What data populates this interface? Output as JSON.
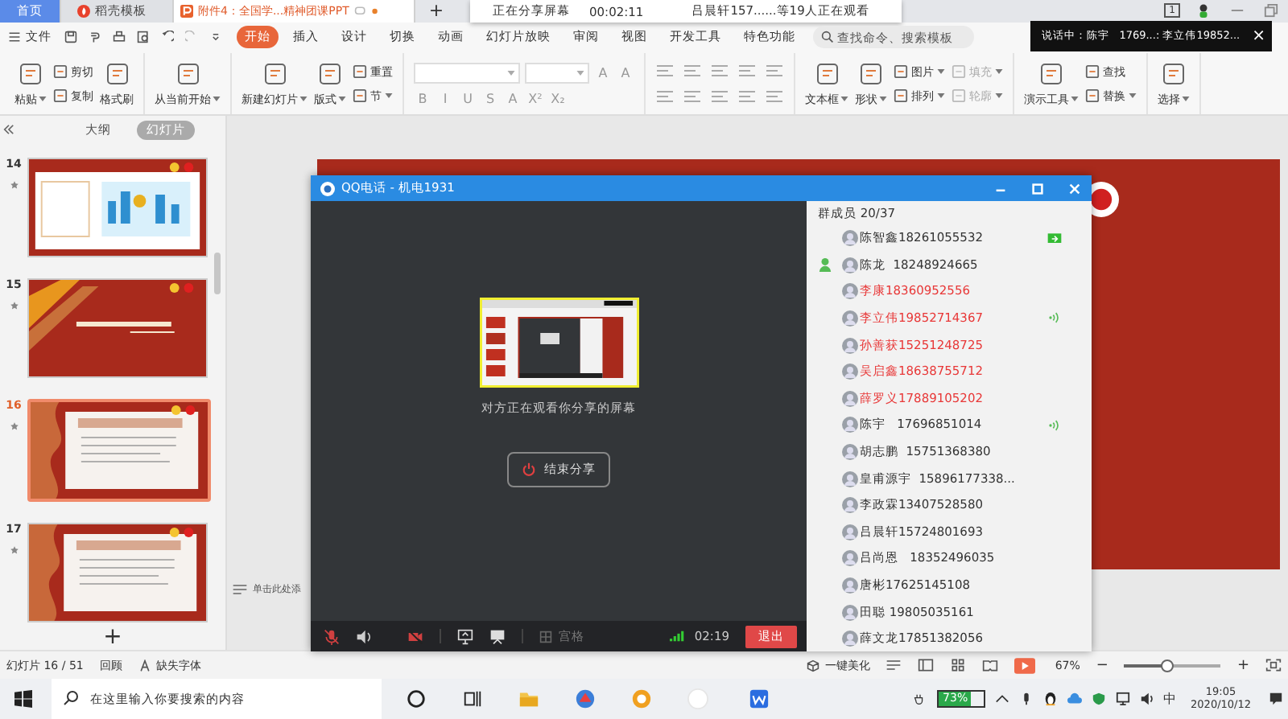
{
  "tabs": [
    {
      "label": "首页",
      "kind": "home",
      "selected": false
    },
    {
      "label": "稻壳模板",
      "kind": "docer",
      "selected": false
    },
    {
      "label": "附件4：全国学...精神团课PPT",
      "kind": "doc",
      "selected": true
    }
  ],
  "new_tab": "+",
  "share_banner": {
    "status": "正在分享屏幕",
    "elapsed": "00:02:11",
    "viewers": "吕晨轩157......等19人正在观看"
  },
  "window_count": "1",
  "menu": {
    "file": "文件",
    "tabs": [
      {
        "label": "开始",
        "selected": true
      },
      {
        "label": "插入",
        "selected": false
      },
      {
        "label": "设计",
        "selected": false
      },
      {
        "label": "切换",
        "selected": false
      },
      {
        "label": "动画",
        "selected": false
      },
      {
        "label": "幻灯片放映",
        "selected": false
      },
      {
        "label": "审阅",
        "selected": false
      },
      {
        "label": "视图",
        "selected": false
      },
      {
        "label": "开发工具",
        "selected": false
      },
      {
        "label": "特色功能",
        "selected": false
      }
    ],
    "search": {
      "placeholder": "查找命令、搜索模板"
    }
  },
  "speaking_toast": {
    "text": "说话中：陈宇   1769...: 李立伟19852...",
    "close": "×"
  },
  "ribbon": {
    "groups": [
      {
        "tools": [
          {
            "kind": "large",
            "label": "粘贴",
            "caret": true
          },
          {
            "kind": "pair",
            "items": [
              {
                "label": "剪切",
                "caret": false,
                "disabled": false
              },
              {
                "label": "复制",
                "caret": false,
                "disabled": false
              }
            ]
          },
          {
            "kind": "large",
            "label": "格式刷",
            "caret": false
          }
        ]
      },
      {
        "tools": [
          {
            "kind": "large",
            "label": "从当前开始",
            "caret": true
          }
        ]
      },
      {
        "tools": [
          {
            "kind": "large",
            "label": "新建幻灯片",
            "caret": true
          },
          {
            "kind": "large",
            "label": "版式",
            "caret": true
          },
          {
            "kind": "pair",
            "items": [
              {
                "label": "重置",
                "caret": false,
                "disabled": false
              },
              {
                "label": "节",
                "caret": true,
                "disabled": false
              }
            ]
          }
        ]
      },
      {
        "tools": [
          {
            "kind": "font",
            "size_buttons": [
              "A",
              "A"
            ],
            "format_buttons": [
              "B",
              "I",
              "U",
              "S",
              "A",
              "X²",
              "X₂"
            ]
          }
        ]
      },
      {
        "tools": [
          {
            "kind": "paragraph"
          }
        ]
      },
      {
        "tools": [
          {
            "kind": "large",
            "label": "文本框",
            "caret": true
          },
          {
            "kind": "large",
            "label": "形状",
            "caret": true
          },
          {
            "kind": "pair",
            "items": [
              {
                "label": "图片",
                "caret": true,
                "disabled": false
              },
              {
                "label": "排列",
                "caret": true,
                "disabled": false
              }
            ]
          },
          {
            "kind": "pair",
            "items": [
              {
                "label": "填充",
                "caret": true,
                "disabled": true
              },
              {
                "label": "轮廓",
                "caret": true,
                "disabled": true
              }
            ]
          }
        ]
      },
      {
        "tools": [
          {
            "kind": "large",
            "label": "演示工具",
            "caret": true
          },
          {
            "kind": "pair",
            "items": [
              {
                "label": "查找",
                "caret": false,
                "disabled": false
              },
              {
                "label": "替换",
                "caret": true,
                "disabled": false
              }
            ]
          }
        ]
      },
      {
        "tools": [
          {
            "kind": "large",
            "label": "选择",
            "caret": true
          }
        ]
      }
    ]
  },
  "slide_panel": {
    "tabs": [
      {
        "label": "大纲",
        "selected": false
      },
      {
        "label": "幻灯片",
        "selected": true
      }
    ],
    "slides": [
      {
        "number": "14",
        "kind": "city",
        "selected": false
      },
      {
        "number": "15",
        "kind": "section",
        "selected": false
      },
      {
        "number": "16",
        "kind": "text",
        "selected": true
      },
      {
        "number": "17",
        "kind": "text",
        "selected": false
      }
    ],
    "add": "+"
  },
  "notes": {
    "placeholder": "单击此处添"
  },
  "call_window": {
    "title": "QQ电话 - 机电1931",
    "message": "对方正在观看你分享的屏幕",
    "stop_button": "结束分享",
    "layout_button": "宫格",
    "duration": "02:19",
    "exit_button": "退出",
    "mic_muted": true,
    "camera_off": true,
    "members_header": "群成员 20/37",
    "members": [
      {
        "label": "陈智鑫18261055532",
        "highlighted": false,
        "admin": false,
        "sharing": true,
        "speaking": false
      },
      {
        "label": "陈龙  18248924665",
        "highlighted": false,
        "admin": true,
        "sharing": false,
        "speaking": false
      },
      {
        "label": "李康18360952556",
        "highlighted": true,
        "admin": false,
        "sharing": false,
        "speaking": false
      },
      {
        "label": "李立伟19852714367",
        "highlighted": true,
        "admin": false,
        "sharing": false,
        "speaking": true
      },
      {
        "label": "孙善获15251248725",
        "highlighted": true,
        "admin": false,
        "sharing": false,
        "speaking": false
      },
      {
        "label": "吴启鑫18638755712",
        "highlighted": true,
        "admin": false,
        "sharing": false,
        "speaking": false
      },
      {
        "label": "薛罗义17889105202",
        "highlighted": true,
        "admin": false,
        "sharing": false,
        "speaking": false
      },
      {
        "label": "陈宇   17696851014",
        "highlighted": false,
        "admin": false,
        "sharing": false,
        "speaking": true
      },
      {
        "label": "胡志鹏  15751368380",
        "highlighted": false,
        "admin": false,
        "sharing": false,
        "speaking": false
      },
      {
        "label": "皇甫源宇  15896177338...",
        "highlighted": false,
        "admin": false,
        "sharing": false,
        "speaking": false
      },
      {
        "label": "李政霖13407528580",
        "highlighted": false,
        "admin": false,
        "sharing": false,
        "speaking": false
      },
      {
        "label": "吕晨轩15724801693",
        "highlighted": false,
        "admin": false,
        "sharing": false,
        "speaking": false
      },
      {
        "label": "吕尚恩   18352496035",
        "highlighted": false,
        "admin": false,
        "sharing": false,
        "speaking": false
      },
      {
        "label": "唐彬17625145108",
        "highlighted": false,
        "admin": false,
        "sharing": false,
        "speaking": false
      },
      {
        "label": "田聪 19805035161",
        "highlighted": false,
        "admin": false,
        "sharing": false,
        "speaking": false
      },
      {
        "label": "薛文龙17851382056",
        "highlighted": false,
        "admin": false,
        "sharing": false,
        "speaking": false
      }
    ]
  },
  "status_bar": {
    "slide_counter": "幻灯片 16 / 51",
    "review": "回顾",
    "missing_fonts": "缺失字体",
    "beautify": "一键美化",
    "zoom": "67%",
    "zoom_out": "−",
    "zoom_in": "+",
    "zoom_slider": {
      "level": 0.45
    }
  },
  "taskbar": {
    "search": {
      "placeholder": "在这里输入你要搜索的内容"
    },
    "battery": {
      "label": "73%",
      "level": 0.73
    },
    "ime": "中",
    "time": "19:05",
    "date": "2020/10/12"
  }
}
